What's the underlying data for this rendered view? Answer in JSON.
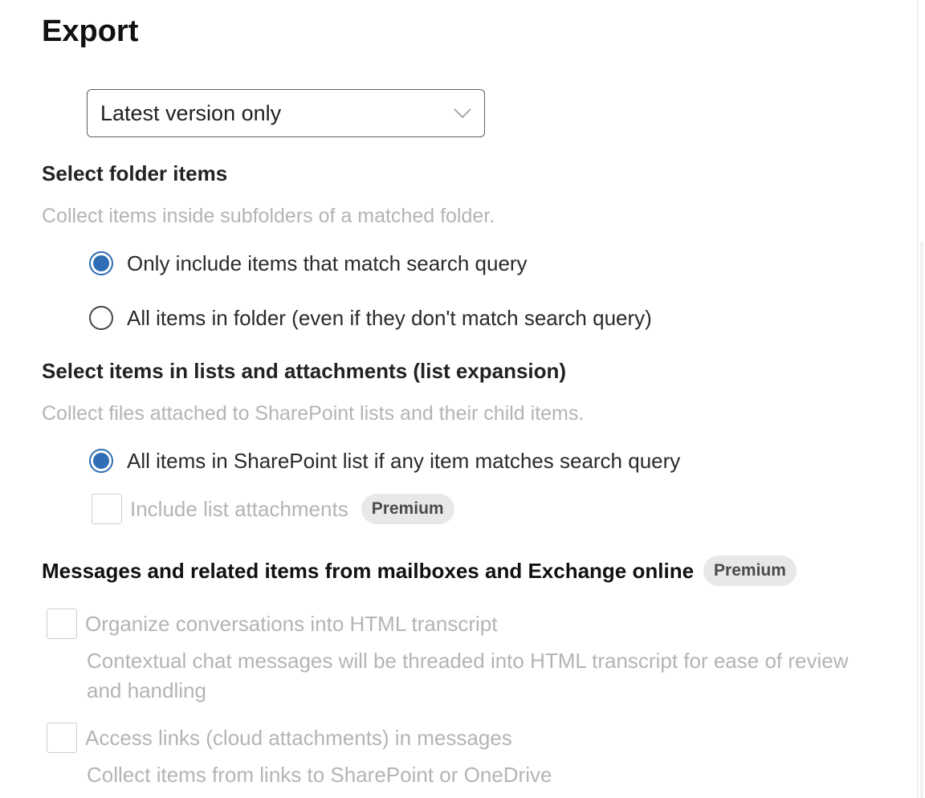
{
  "page": {
    "title": "Export"
  },
  "version_dropdown": {
    "selected": "Latest version only",
    "icon": "chevron-down-icon"
  },
  "folder_items": {
    "heading": "Select folder items",
    "description": "Collect items inside subfolders of a matched folder.",
    "options": [
      {
        "label": "Only include items that match search query",
        "checked": true
      },
      {
        "label": "All items in folder (even if they don't match search query)",
        "checked": false
      }
    ]
  },
  "list_expansion": {
    "heading": "Select items in lists and attachments (list expansion)",
    "description": "Collect files attached to SharePoint lists and their child items.",
    "option": {
      "label": "All items in SharePoint list if any item matches search query",
      "checked": true
    },
    "attachments": {
      "label": "Include list attachments",
      "badge": "Premium",
      "checked": false
    }
  },
  "messages": {
    "heading": "Messages and related items from mailboxes and Exchange online",
    "badge": "Premium",
    "options": [
      {
        "label": "Organize conversations into HTML transcript",
        "description": "Contextual chat messages will be threaded into HTML transcript for ease of review and handling",
        "checked": false
      },
      {
        "label": "Access links (cloud attachments) in messages",
        "description": "Collect items from links to SharePoint or OneDrive",
        "checked": false
      }
    ]
  },
  "colors": {
    "accent": "#2f6db5",
    "disabled_text": "#b4b4b4",
    "badge_bg": "#e8e8e8"
  }
}
